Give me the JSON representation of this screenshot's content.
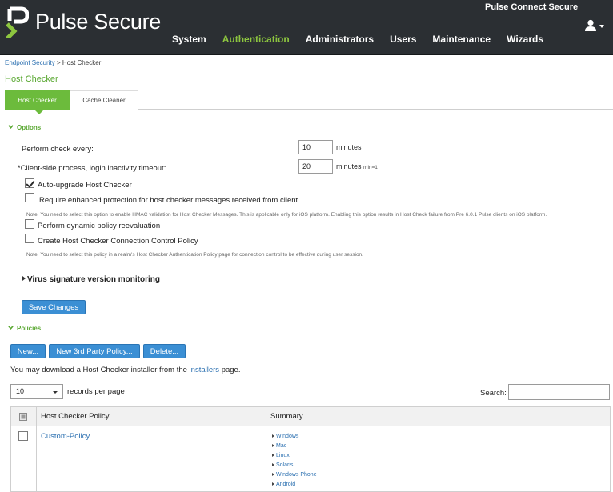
{
  "header": {
    "brand": "Pulse Secure",
    "product": "Pulse Connect Secure",
    "nav": [
      "System",
      "Authentication",
      "Administrators",
      "Users",
      "Maintenance",
      "Wizards"
    ],
    "active_nav": "Authentication",
    "user_icon": "user-icon"
  },
  "breadcrumb": {
    "parent": "Endpoint Security",
    "separator": ">",
    "current": "Host Checker"
  },
  "page_title": "Host Checker",
  "tabs": [
    {
      "label": "Host Checker",
      "active": true
    },
    {
      "label": "Cache Cleaner",
      "active": false
    }
  ],
  "options": {
    "header": "Options",
    "check_every_label": "Perform check every:",
    "check_every_value": "10",
    "check_every_unit": "minutes",
    "timeout_label": "*Client-side process, login inactivity timeout:",
    "timeout_value": "20",
    "timeout_unit": "minutes",
    "timeout_hint": "min=1",
    "auto_upgrade_label": "Auto-upgrade Host Checker",
    "auto_upgrade_checked": true,
    "enhanced_label": "Require enhanced protection for host checker messages received from client",
    "enhanced_checked": false,
    "enhanced_note": "Note: You need to select this option to enable HMAC validation for Host Checker Messages. This is applicable only for iOS platform. Enabling this option results in Host Check failure from Pre 6.0.1 Pulse clients on iOS platform.",
    "dynamic_label": "Perform dynamic policy reevaluation",
    "dynamic_checked": false,
    "connection_label": "Create Host Checker Connection Control Policy",
    "connection_checked": false,
    "connection_note": "Note: You need to select this policy in a realm's Host Checker Authentication Policy page for connection control to be effective during user session.",
    "virus_toggle": "Virus signature version monitoring",
    "save_button": "Save Changes"
  },
  "policies": {
    "header": "Policies",
    "new_button": "New...",
    "third_party_button": "New 3rd Party Policy...",
    "delete_button": "Delete...",
    "info_prefix": "You may download a Host Checker installer from the",
    "info_link": "installers",
    "info_suffix": "page.",
    "records_value": "10",
    "records_label": "records per page",
    "search_label": "Search:",
    "search_value": "",
    "table": {
      "col_policy": "Host Checker Policy",
      "col_summary": "Summary",
      "rows": [
        {
          "policy": "Custom-Policy",
          "summary": [
            "Windows",
            "Mac",
            "Linux",
            "Solaris",
            "Windows Phone",
            "Android"
          ]
        }
      ]
    }
  },
  "colors": {
    "header_bg": "#2b2f33",
    "accent_green": "#6cbb3c",
    "button_blue": "#3b8fd4",
    "link_blue": "#2a6fb0"
  }
}
